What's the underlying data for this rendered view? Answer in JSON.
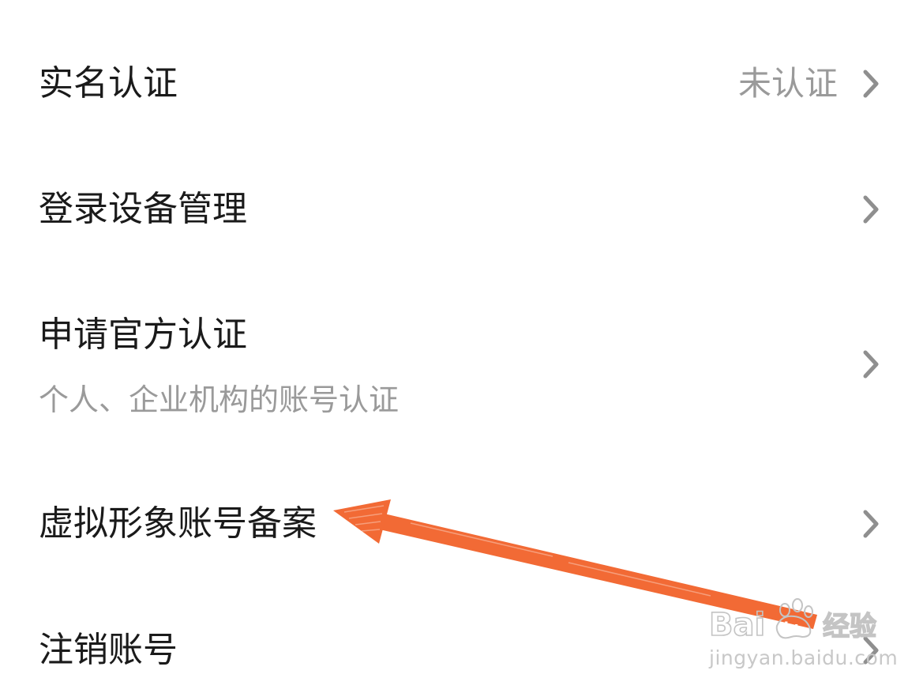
{
  "settings": {
    "items": [
      {
        "title": "实名认证",
        "value": "未认证"
      },
      {
        "title": "登录设备管理"
      },
      {
        "title": "申请官方认证",
        "subtitle": "个人、企业机构的账号认证"
      },
      {
        "title": "虚拟形象账号备案"
      },
      {
        "title": "注销账号"
      }
    ]
  },
  "annotation": {
    "arrow_color": "#f26a35",
    "points_to": "虚拟形象账号备案"
  },
  "watermark": {
    "logo_text": "Bai du 经验",
    "url": "jingyan.baidu.com"
  },
  "icons": {
    "row_chevron": "chevron-right-icon",
    "watermark_logo": "baidu-paw-logo"
  }
}
